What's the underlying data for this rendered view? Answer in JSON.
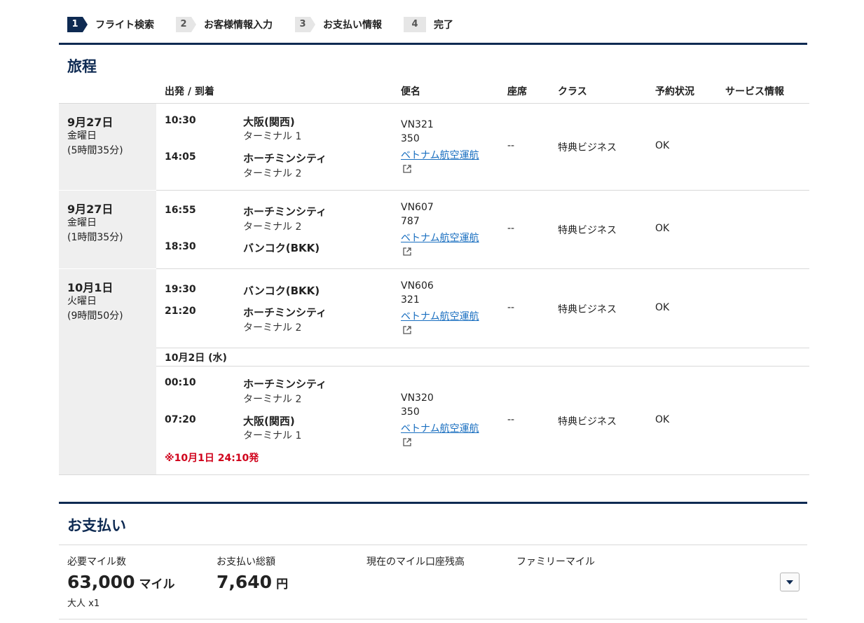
{
  "steps": [
    {
      "num": "1",
      "label": "フライト検索"
    },
    {
      "num": "2",
      "label": "お客様情報入力"
    },
    {
      "num": "3",
      "label": "お支払い情報"
    },
    {
      "num": "4",
      "label": "完了"
    }
  ],
  "itinerary": {
    "title": "旅程",
    "headers": {
      "depart_arrive": "出発 / 到着",
      "flight": "便名",
      "seat": "座席",
      "class": "クラス",
      "status": "予約状況",
      "service": "サービス情報"
    },
    "days": [
      {
        "date": "9月27日",
        "weekday": "金曜日",
        "duration": "(5時間35分)"
      },
      {
        "date": "9月27日",
        "weekday": "金曜日",
        "duration": "(1時間35分)"
      },
      {
        "date": "10月1日",
        "weekday": "火曜日",
        "duration": "(9時間50分)"
      }
    ],
    "segments": [
      {
        "dep_time": "10:30",
        "dep_port": "大阪(関西)",
        "dep_term": "ターミナル 1",
        "arr_time": "14:05",
        "arr_port": "ホーチミンシティ",
        "arr_term": "ターミナル 2",
        "flight": "VN321",
        "aircraft": "350",
        "operator": "ベトナム航空運航",
        "seat": "--",
        "class": "特典ビジネス",
        "status": "OK"
      },
      {
        "dep_time": "16:55",
        "dep_port": "ホーチミンシティ",
        "dep_term": "ターミナル 2",
        "arr_time": "18:30",
        "arr_port": "バンコク(BKK)",
        "flight": "VN607",
        "aircraft": "787",
        "operator": "ベトナム航空運航",
        "seat": "--",
        "class": "特典ビジネス",
        "status": "OK"
      },
      {
        "dep_time": "19:30",
        "dep_port": "バンコク(BKK)",
        "arr_time": "21:20",
        "arr_port": "ホーチミンシティ",
        "arr_term": "ターミナル 2",
        "flight": "VN606",
        "aircraft": "321",
        "operator": "ベトナム航空運航",
        "seat": "--",
        "class": "特典ビジネス",
        "status": "OK"
      },
      {
        "dep_time": "00:10",
        "dep_port": "ホーチミンシティ",
        "dep_term": "ターミナル 2",
        "arr_time": "07:20",
        "arr_port": "大阪(関西)",
        "arr_term": "ターミナル 1",
        "flight": "VN320",
        "aircraft": "350",
        "operator": "ベトナム航空運航",
        "seat": "--",
        "class": "特典ビジネス",
        "status": "OK"
      }
    ],
    "next_day_label": "10月2日 (水)",
    "departure_note": "※10月1日 24:10発"
  },
  "payment": {
    "title": "お支払い",
    "miles_label": "必要マイル数",
    "miles_value": "63,000",
    "miles_unit": "マイル",
    "passengers": "大人 x1",
    "total_label": "お支払い総額",
    "total_value": "7,640",
    "total_unit": "円",
    "balance_label": "現在のマイル口座残高",
    "family_label": "ファミリーマイル"
  },
  "icons": {
    "external_link": "external-link-icon",
    "dropdown": "chevron-down-icon"
  },
  "colors": {
    "brand_navy": "#0e2a52",
    "link_blue": "#1a6fc0",
    "note_red": "#d0021b"
  }
}
